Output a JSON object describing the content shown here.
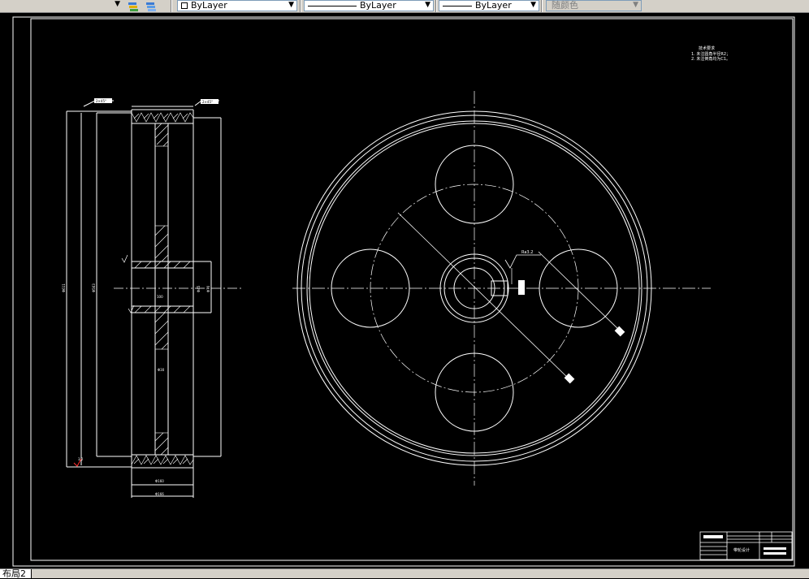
{
  "toolbar": {
    "layer_dropdown": "",
    "color_dropdown": "ByLayer",
    "linetype_dropdown": "ByLayer",
    "lineweight_dropdown": "ByLayer",
    "plotstyle_dropdown": "随颜色"
  },
  "drawing": {
    "notes_title": "技术要求",
    "notes": [
      "1. 未注圆角半径R2；",
      "2. 未注倒角均为C1。"
    ],
    "side_view_dims": {
      "top_left": "2×45°",
      "top_right": "2×45°",
      "outer_dia": "Φ611",
      "inner_dia": "Φ563",
      "bore": "Φ45",
      "hub": "Φ70",
      "hub_len": "100",
      "web": "Φ30",
      "width1": "Φ160",
      "width2": "Φ166",
      "roughness": "3.2"
    },
    "front_view_dims": {
      "roughness": "Ra3.2"
    },
    "title_block": {
      "name": "带轮设计"
    }
  },
  "statusbar": {
    "layout_tab": "布局2"
  }
}
